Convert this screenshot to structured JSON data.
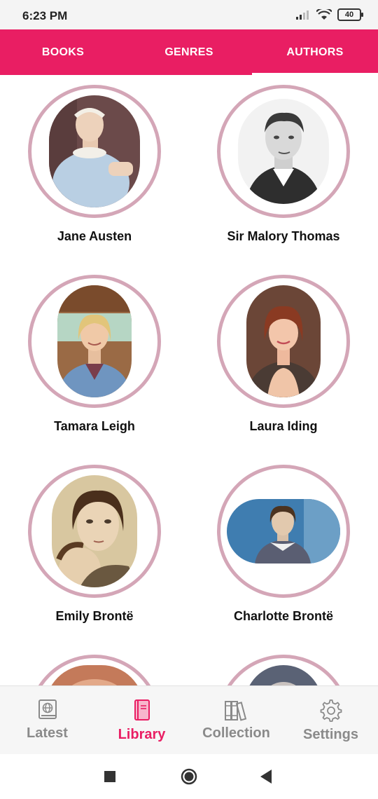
{
  "status_bar": {
    "time": "6:23 PM",
    "battery": "40"
  },
  "tabs": [
    {
      "label": "BOOKS",
      "active": false
    },
    {
      "label": "GENRES",
      "active": false
    },
    {
      "label": "AUTHORS",
      "active": true
    }
  ],
  "authors": [
    {
      "name": "Jane Austen"
    },
    {
      "name": "Sir Malory Thomas"
    },
    {
      "name": "Tamara Leigh"
    },
    {
      "name": "Laura Iding"
    },
    {
      "name": "Emily Brontë"
    },
    {
      "name": "Charlotte Brontë"
    }
  ],
  "bottom_nav": [
    {
      "label": "Latest",
      "icon": "globe-book-icon",
      "active": false
    },
    {
      "label": "Library",
      "icon": "book-icon",
      "active": true
    },
    {
      "label": "Collection",
      "icon": "bookshelf-icon",
      "active": false
    },
    {
      "label": "Settings",
      "icon": "gear-icon",
      "active": false
    }
  ],
  "colors": {
    "accent": "#e91e63",
    "ring": "#d4a6b7",
    "nav_inactive": "#8a8a8a"
  }
}
